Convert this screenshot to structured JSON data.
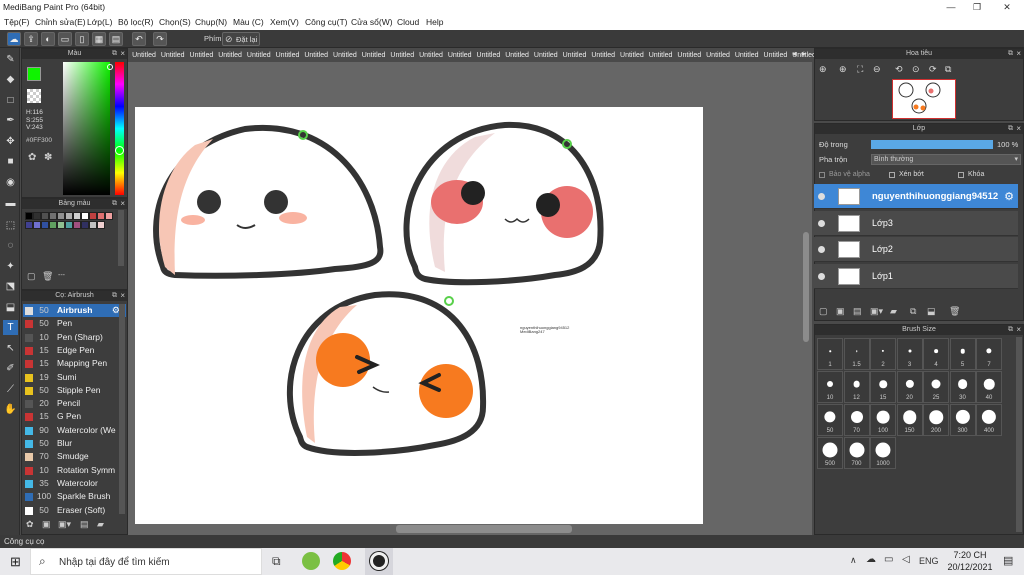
{
  "app": {
    "title": "MediBang Paint Pro (64bit)"
  },
  "menu": [
    "Tệp(F)",
    "Chỉnh sửa(E)",
    "Lớp(L)",
    "Bộ lọc(R)",
    "Chọn(S)",
    "Chụp(N)",
    "Màu (C)",
    "Xem(V)",
    "Công cụ(T)",
    "Cửa sổ(W)",
    "Cloud",
    "Help"
  ],
  "toolbar": {
    "phim_label": "Phím",
    "reset_label": "Đặt lại"
  },
  "tabs": [
    "Untitled",
    "Untitled",
    "Untitled",
    "Untitled",
    "Untitled",
    "Untitled",
    "Untitled",
    "Untitled",
    "Untitled",
    "Untitled",
    "Untitled",
    "Untitled",
    "Untitled",
    "Untitled",
    "Untitled",
    "Untitled",
    "Untitled",
    "Untitled",
    "Untitled",
    "Untitled",
    "Untitled",
    "Untitled",
    "Untitled",
    "Untitled",
    "Untitled",
    "Untitled",
    "Untitled"
  ],
  "color_panel": {
    "title": "Màu",
    "h": "H:116",
    "s": "S:255",
    "v": "V:243",
    "hex": "#0FF300",
    "primary": "#0ff300"
  },
  "swatch_panel": {
    "title": "Bảng màu",
    "status": "---",
    "colors": [
      "#000000",
      "#303030",
      "#505050",
      "#707070",
      "#909090",
      "#b0b0b0",
      "#d0d0d0",
      "#ffffff",
      "#c04040",
      "#e07070",
      "#f0a0a0",
      "#404090",
      "#7070d0",
      "#3050a0",
      "#60a060",
      "#90c090",
      "#50a0a0",
      "#a05080",
      "#303060",
      "#c0c0c0",
      "#f0d0d0"
    ]
  },
  "brush_panel": {
    "title": "Cọ: Airbrush",
    "items": [
      {
        "size": "50",
        "name": "Airbrush",
        "color": "#dddddd",
        "selected": true
      },
      {
        "size": "50",
        "name": "Pen",
        "color": "#c93434"
      },
      {
        "size": "10",
        "name": "Pen (Sharp)",
        "color": "#555555"
      },
      {
        "size": "15",
        "name": "Edge Pen",
        "color": "#c93434"
      },
      {
        "size": "15",
        "name": "Mapping Pen",
        "color": "#c93434"
      },
      {
        "size": "19",
        "name": "Sumi",
        "color": "#e8c21e"
      },
      {
        "size": "50",
        "name": "Stipple Pen",
        "color": "#e8c21e"
      },
      {
        "size": "20",
        "name": "Pencil",
        "color": "#555555"
      },
      {
        "size": "15",
        "name": "G Pen",
        "color": "#c93434"
      },
      {
        "size": "90",
        "name": "Watercolor (We",
        "color": "#44b8e6"
      },
      {
        "size": "50",
        "name": "Blur",
        "color": "#44b8e6"
      },
      {
        "size": "70",
        "name": "Smudge",
        "color": "#e8c8a8"
      },
      {
        "size": "10",
        "name": "Rotation Symm",
        "color": "#c93434"
      },
      {
        "size": "35",
        "name": "Watercolor",
        "color": "#44b8e6"
      },
      {
        "size": "100",
        "name": "Sparkle Brush",
        "color": "#2f6db5"
      },
      {
        "size": "50",
        "name": "Eraser (Soft)",
        "color": "#ffffff"
      }
    ]
  },
  "navigator": {
    "title": "Hoa tiêu"
  },
  "layer_panel": {
    "title": "Lớp",
    "opacity_label": "Độ trong",
    "opacity_value": "100 %",
    "blend_label": "Pha trộn",
    "blend_value": "Bình thường",
    "protect_alpha": "Bảo vệ alpha",
    "clip": "Xén bớt",
    "lock": "Khóa",
    "layers": [
      {
        "name": "nguyenthihuonggiang94512",
        "selected": true
      },
      {
        "name": "Lớp3"
      },
      {
        "name": "Lớp2"
      },
      {
        "name": "Lớp1"
      }
    ]
  },
  "brush_size": {
    "title": "Brush Size",
    "sizes": [
      "1",
      "1.5",
      "2",
      "3",
      "4",
      "5",
      "7",
      "10",
      "12",
      "15",
      "20",
      "25",
      "30",
      "40",
      "50",
      "70",
      "100",
      "150",
      "200",
      "300",
      "400",
      "500",
      "700",
      "1000"
    ]
  },
  "canvas": {
    "signature_line1": "nguyenthihuonggiang94512",
    "signature_line2": "MediBang247"
  },
  "status": {
    "text": "Công cụ cọ"
  },
  "taskbar": {
    "search_placeholder": "Nhập tại đây để tìm kiếm",
    "time": "7:20 CH",
    "date": "20/12/2021",
    "lang": "ENG"
  }
}
